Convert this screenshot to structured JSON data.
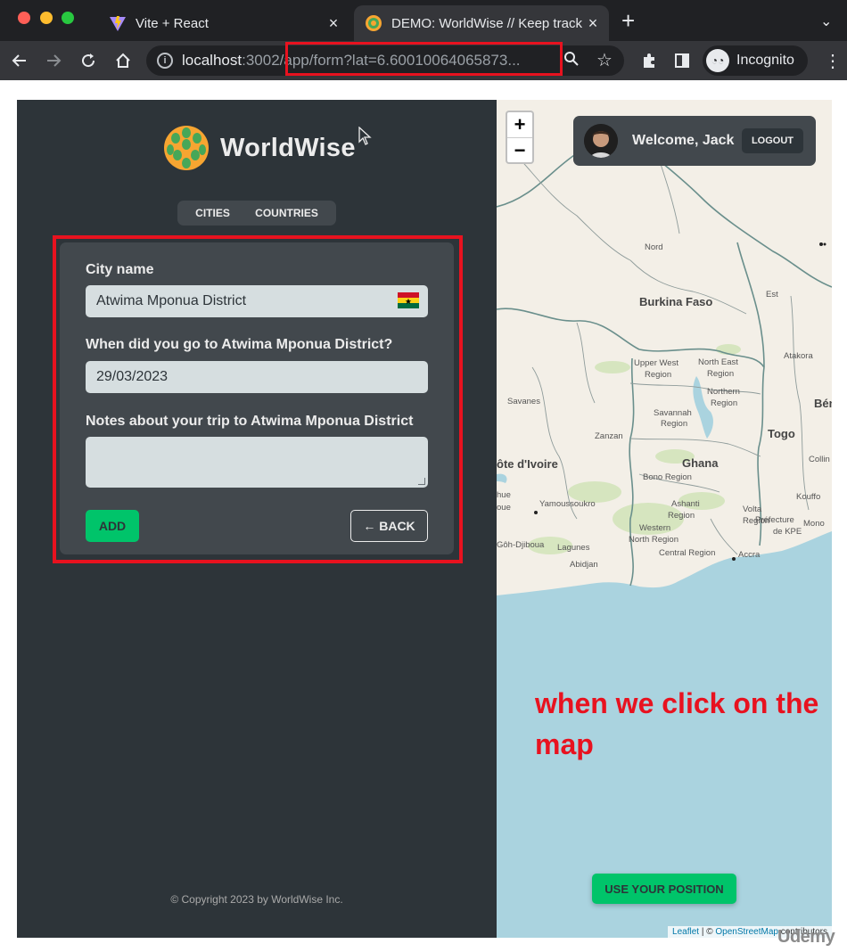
{
  "browser": {
    "tabs": [
      {
        "title": "Vite + React",
        "close": "×"
      },
      {
        "title": "DEMO: WorldWise // Keep track",
        "close": "×"
      }
    ],
    "new_tab": "+",
    "tab_menu": "⌄",
    "url_host": "localhost",
    "url_port": ":3002",
    "url_path": "/app/form?lat=6.600100640658​73...",
    "profile": "Incognito"
  },
  "app": {
    "logo_text": "WorldWise",
    "nav": {
      "cities": "CITIES",
      "countries": "COUNTRIES"
    },
    "form": {
      "city_label": "City name",
      "city_value": "Atwima Mponua District",
      "date_label": "When did you go to Atwima Mponua District?",
      "date_value": "29/03/2023",
      "notes_label": "Notes about your trip to Atwima Mponua District",
      "notes_value": "",
      "add_label": "ADD",
      "back_label": "← BACK"
    },
    "copyright": "© Copyright 2023 by WorldWise Inc."
  },
  "map": {
    "zoom_in": "+",
    "zoom_out": "−",
    "user_name": "Welcome, Jack",
    "logout": "LOGOUT",
    "use_position": "USE YOUR POSITION",
    "attribution_leaflet": "Leaflet",
    "attribution_sep": " | © ",
    "attribution_osm": "OpenStreetMap",
    "attribution_tail": " contributors",
    "labels": {
      "nord": "Nord",
      "est": "Est",
      "burkina": "Burkina Faso",
      "atakora": "Atakora",
      "upper_west": "Upper West",
      "region1": "Region",
      "north_east": "North East",
      "region2": "Region",
      "northern": "Northern",
      "region3": "Region",
      "savanes": "Savanes",
      "savannah": "Savannah",
      "region4": "Region",
      "zanzan": "Zanzan",
      "togo": "Togo",
      "ben": "Bén",
      "collines": "Collin",
      "cote": "ôte d'Ivoire",
      "ghana": "Ghana",
      "bono": "Bono Region",
      "yamoussoukro": "Yamoussoukro",
      "ashanti": "Ashanti",
      "region5": "Region",
      "volta": "Volta",
      "region6": "Region",
      "kouffo": "Kouffo",
      "prefecture": "Préfecture",
      "dekpe": "de KPE",
      "mono": "Mono",
      "western": "Western",
      "north_region": "North Region",
      "goh": "Gôh-Djiboua",
      "lagunes": "Lagunes",
      "central": "Central Region",
      "accra": "Accra",
      "abidjan": "Abidjan",
      "hue": "hue",
      "oue": "oue"
    }
  },
  "annotation": "when we click on the map",
  "watermark": "Udemy",
  "colors": {
    "sidebar": "#2d3439",
    "panel": "#42484d",
    "accent": "#00c46a",
    "highlight": "#e8121f",
    "sea": "#aad3df"
  }
}
